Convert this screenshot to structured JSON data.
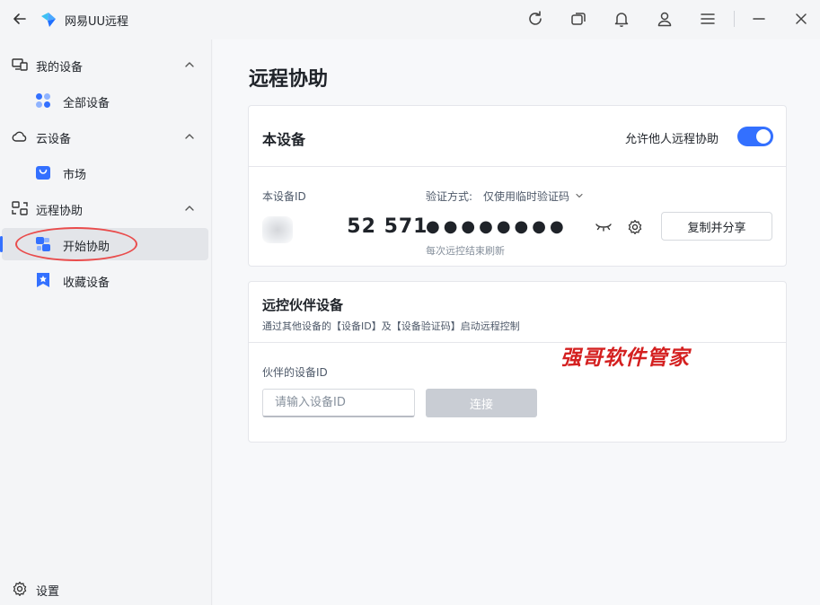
{
  "titlebar": {
    "app_title": "网易UU远程",
    "icons": [
      "back-icon",
      "refresh-icon",
      "window-switch-icon",
      "bell-icon",
      "user-icon",
      "menu-icon",
      "minimize-icon",
      "close-icon"
    ]
  },
  "sidebar": {
    "groups": [
      {
        "label": "我的设备",
        "icon": "devices-icon",
        "items": [
          {
            "label": "全部设备",
            "icon": "grid-dots-icon"
          }
        ]
      },
      {
        "label": "云设备",
        "icon": "cloud-icon",
        "items": [
          {
            "label": "市场",
            "icon": "shopping-bag-icon"
          }
        ]
      },
      {
        "label": "远程协助",
        "icon": "remote-assist-icon",
        "items": [
          {
            "label": "开始协助",
            "icon": "start-assist-icon",
            "active": true
          },
          {
            "label": "收藏设备",
            "icon": "star-bookmark-icon"
          }
        ]
      }
    ],
    "settings_label": "设置"
  },
  "main": {
    "page_title": "远程协助",
    "this_device": {
      "title": "本设备",
      "allow_label": "允许他人远程协助",
      "allow_enabled": true,
      "device_id_label": "本设备ID",
      "device_id_value": "     52 571",
      "verify_label": "验证方式:",
      "verify_value": "仅使用临时验证码",
      "password_mask": "●●●●●●●●",
      "refresh_hint": "每次远控结束刷新",
      "copy_button": "复制并分享"
    },
    "partner_device": {
      "title": "远控伙伴设备",
      "subtitle": "通过其他设备的【设备ID】及【设备验证码】启动远程控制",
      "partner_id_label": "伙伴的设备ID",
      "input_placeholder": "请输入设备ID",
      "input_value": "",
      "connect_button": "连接"
    },
    "watermark": "强哥软件管家"
  },
  "colors": {
    "accent": "#3370ff",
    "annotation": "#e94c4c",
    "watermark": "#d42020"
  }
}
